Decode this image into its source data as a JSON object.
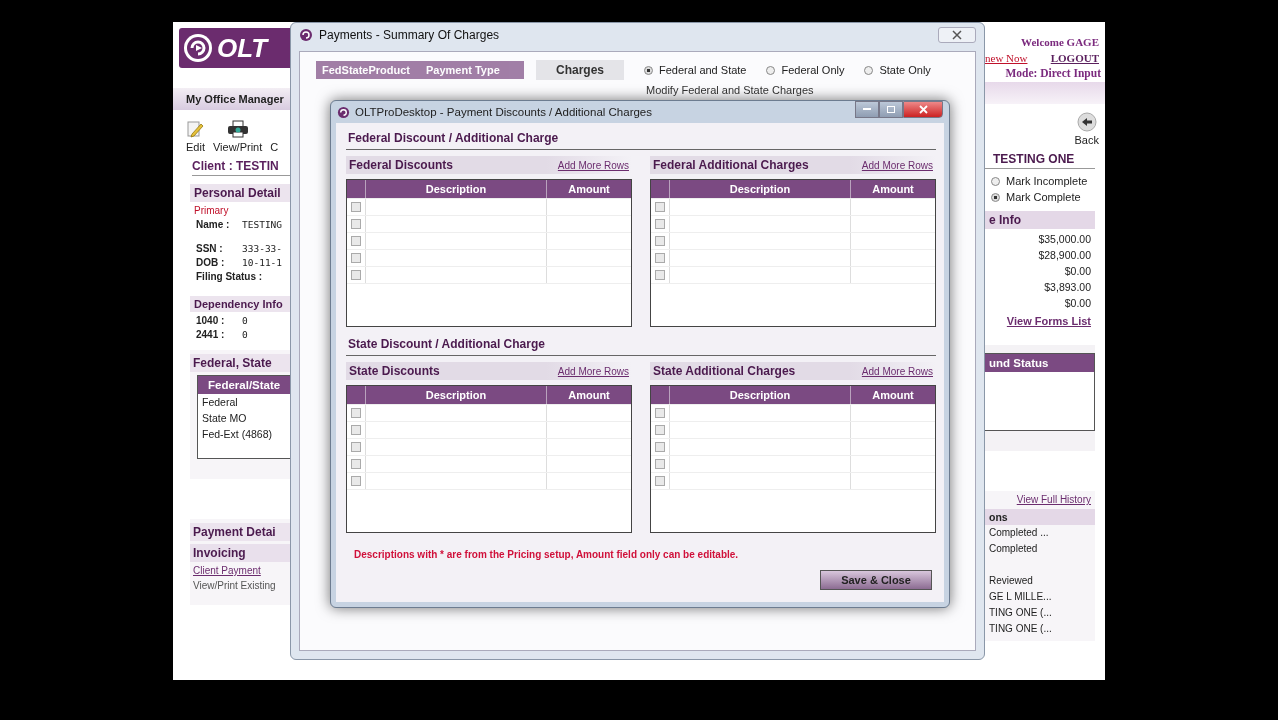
{
  "left": {
    "logo": "OLT",
    "bar": "My Office Manager",
    "tools": [
      {
        "kind": "edit",
        "label": "Edit"
      },
      {
        "kind": "print",
        "label": "View/Print"
      },
      {
        "kind": "none",
        "label": "C"
      }
    ],
    "client": "Client : TESTIN",
    "personal": {
      "title": "Personal Detail",
      "primary": "Primary",
      "fields": [
        {
          "label": "Name :",
          "value": "TESTING"
        },
        {
          "label": "SSN :",
          "value": "333-33-"
        },
        {
          "label": "DOB :",
          "value": "10-11-1"
        },
        {
          "label": "Filing Status :"
        }
      ]
    },
    "dependency": {
      "title": "Dependency Info",
      "rows": [
        {
          "label": "1040 :",
          "value": "0"
        },
        {
          "label": "2441 :",
          "value": "0"
        }
      ]
    },
    "returns": {
      "title": "Federal, State",
      "header": "Federal/State",
      "rows": [
        "Federal",
        "State MO",
        "Fed-Ext (4868)"
      ]
    },
    "payment": {
      "title": "Payment Detai",
      "subtitle": "Invoicing",
      "link": "Client Payment",
      "text": "View/Print Existing"
    }
  },
  "right": {
    "welcome": "Welcome GAGE",
    "renew": "new Now",
    "logout": "LOGOUT",
    "mode": "Mode: Direct Input",
    "back": "Back",
    "client": "TESTING ONE",
    "status": [
      {
        "label": "Mark Incomplete",
        "selected": false
      },
      {
        "label": "Mark Complete",
        "selected": true
      }
    ],
    "info": {
      "title": "e Info",
      "values": [
        "$35,000.00",
        "$28,900.00",
        "$0.00",
        "$3,893.00",
        "$0.00"
      ],
      "link": "View Forms List"
    },
    "refund": {
      "header": "und Status"
    },
    "history": {
      "link": "View Full History",
      "title": "ons",
      "rows": [
        "Completed ...",
        "Completed",
        "Reviewed",
        "GE L MILLE...",
        "TING ONE (...",
        "TING ONE (..."
      ]
    }
  },
  "payments_window": {
    "title": "Payments - Summary Of Charges",
    "columns": [
      "FedStateProduct",
      "Payment Type"
    ],
    "charges": "Charges",
    "options": [
      {
        "label": "Federal and State",
        "selected": true
      },
      {
        "label": "Federal Only",
        "selected": false
      },
      {
        "label": "State Only",
        "selected": false
      }
    ],
    "modify": "Modify Federal and State Charges"
  },
  "modal": {
    "title": "OLTProDesktop - Payment Discounts / Additional Charges",
    "sections": [
      {
        "heading": "Federal Discount / Additional Charge",
        "grids": [
          {
            "title": "Federal Discounts",
            "link": "Add More Rows",
            "columns": [
              "Description",
              "Amount"
            ],
            "rows": [
              {
                "checked": false
              },
              {
                "checked": false
              },
              {
                "checked": false
              },
              {
                "checked": false
              },
              {
                "checked": false
              }
            ]
          },
          {
            "title": "Federal Additional Charges",
            "link": "Add More Rows",
            "columns": [
              "Description",
              "Amount"
            ],
            "rows": [
              {
                "checked": false
              },
              {
                "checked": false
              },
              {
                "checked": false
              },
              {
                "checked": false
              },
              {
                "checked": false
              }
            ]
          }
        ]
      },
      {
        "heading": "State Discount / Additional Charge",
        "grids": [
          {
            "title": "State Discounts",
            "link": "Add More Rows",
            "columns": [
              "Description",
              "Amount"
            ],
            "rows": [
              {
                "checked": false
              },
              {
                "checked": false
              },
              {
                "checked": false
              },
              {
                "checked": false
              },
              {
                "checked": false
              }
            ]
          },
          {
            "title": "State Additional Charges",
            "link": "Add More Rows",
            "columns": [
              "Description",
              "Amount"
            ],
            "rows": [
              {
                "checked": false
              },
              {
                "checked": false
              },
              {
                "checked": false
              },
              {
                "checked": false
              },
              {
                "checked": false
              }
            ]
          }
        ]
      }
    ],
    "note": "Descriptions with * are from the Pricing setup, Amount field only can be editable.",
    "save": "Save & Close"
  }
}
